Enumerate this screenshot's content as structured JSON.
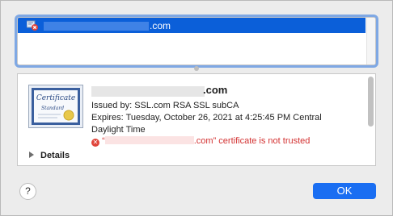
{
  "chain": {
    "selected_domain_suffix": ".com",
    "icon": "certificate-error-icon"
  },
  "certificate": {
    "icon": "certificate-icon",
    "icon_text_top": "Certificate",
    "icon_text_bottom": "Standard",
    "title_suffix": ".com",
    "issued_by": "Issued by: SSL.com RSA SSL subCA",
    "expires_line1": "Expires: Tuesday, October 26, 2021 at 4:25:45 PM Central",
    "expires_line2": "Daylight Time",
    "warning_prefix": "“",
    "warning_suffix": ".com” certificate is not trusted",
    "warning_icon": "error-x-icon"
  },
  "details": {
    "label": "Details",
    "icon": "disclosure-triangle-icon"
  },
  "buttons": {
    "help": "?",
    "ok": "OK"
  },
  "colors": {
    "selection": "#0b5fd9",
    "warning": "#d33131",
    "ok_button": "#1a6ef2"
  }
}
